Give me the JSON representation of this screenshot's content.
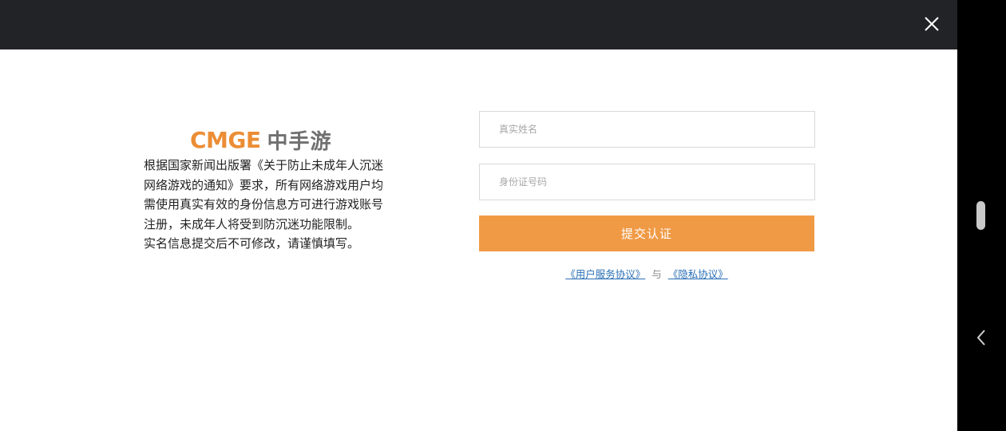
{
  "header": {
    "close_icon": "close-icon"
  },
  "logo": {
    "en": "CMGE",
    "cn": "中手游",
    "colors": {
      "en": "#ec8d35",
      "cn": "#707070"
    }
  },
  "notice": {
    "lines": [
      "根据国家新闻出版署《关于防止未成年人沉迷",
      "网络游戏的通知》要求，所有网络游戏用户均",
      "需使用真实有效的身份信息方可进行游戏账号",
      "注册，未成年人将受到防沉迷功能限制。",
      "实名信息提交后不可修改，请谨慎填写。"
    ]
  },
  "form": {
    "name_placeholder": "真实姓名",
    "id_placeholder": "身份证号码",
    "submit_label": "提交认证",
    "submit_color": "#f09a45"
  },
  "agreements": {
    "user_agreement": "《用户服务协议》",
    "separator": "与",
    "privacy_agreement": "《隐私协议》",
    "link_color": "#2a6fb5"
  },
  "system": {
    "back_icon": "chevron-left-icon"
  }
}
